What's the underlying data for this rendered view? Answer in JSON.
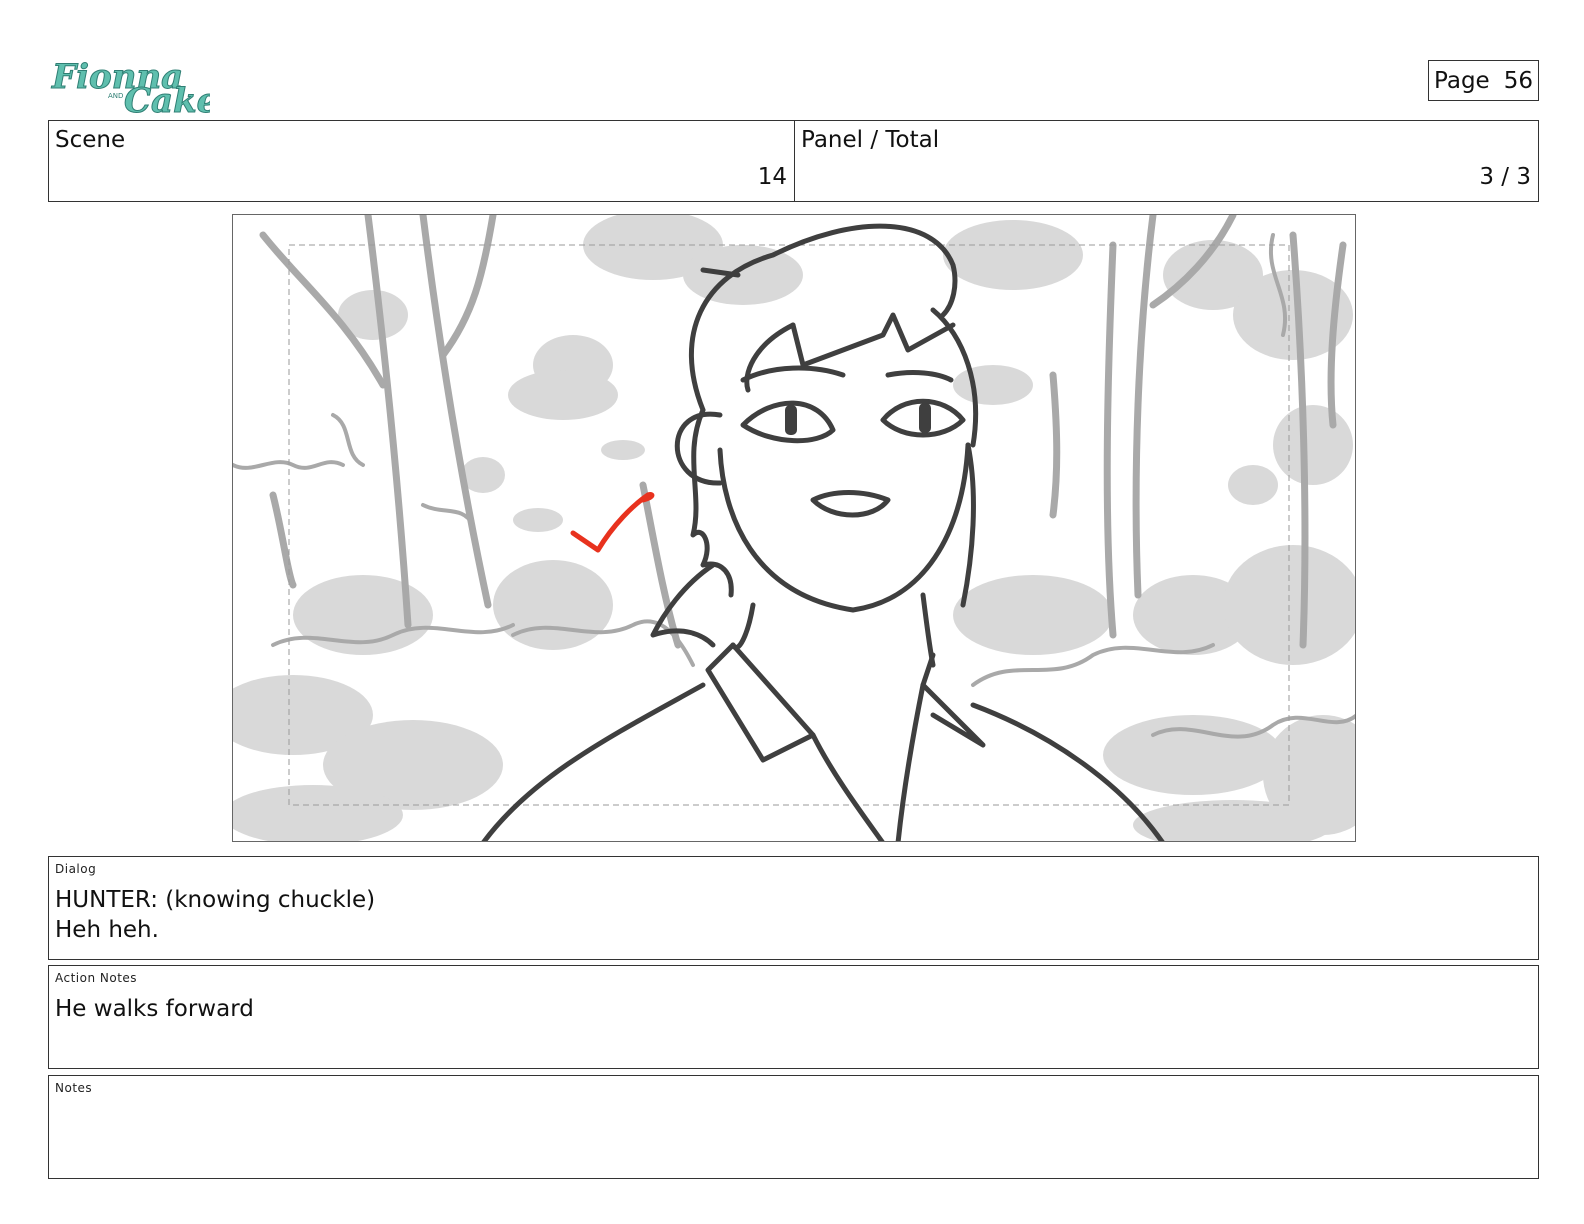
{
  "logo": {
    "text_main": "Fionna",
    "text_and": "AND",
    "text_second": "Cake"
  },
  "page": {
    "label": "Page",
    "number": "56"
  },
  "scene": {
    "label": "Scene",
    "value": "14"
  },
  "panel": {
    "label": "Panel / Total",
    "value": "3 / 3"
  },
  "dialog": {
    "label": "Dialog",
    "line1": "HUNTER: (knowing chuckle)",
    "line2": "Heh heh."
  },
  "action_notes": {
    "label": "Action Notes",
    "text": "He walks forward"
  },
  "notes": {
    "label": "Notes",
    "text": ""
  },
  "colors": {
    "logo": "#5fbfae",
    "line": "#3f3f3f",
    "background_gray": "#d9d9d9",
    "mid_gray": "#a9a9a9",
    "check_mark": "#e8321e"
  },
  "illustration": {
    "description_icon": "storyboard-sketch-icon",
    "mark": "check-mark-icon"
  }
}
